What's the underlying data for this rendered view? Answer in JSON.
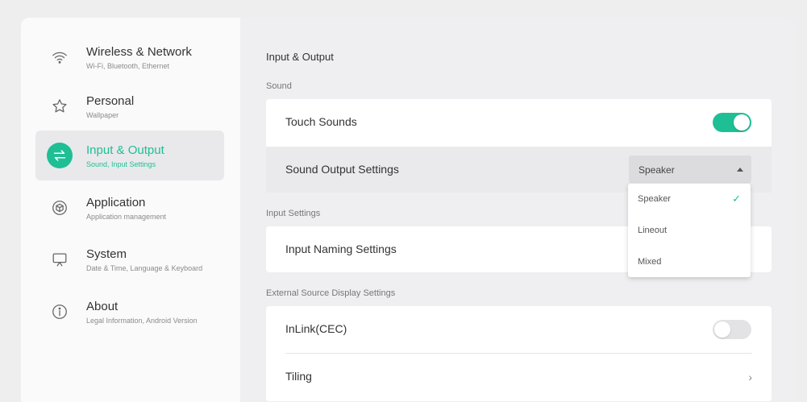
{
  "sidebar": {
    "items": [
      {
        "title": "Wireless & Network",
        "subtitle": "Wi-Fi, Bluetooth, Ethernet",
        "icon": "wifi-icon"
      },
      {
        "title": "Personal",
        "subtitle": "Wallpaper",
        "icon": "star-icon"
      },
      {
        "title": "Input & Output",
        "subtitle": "Sound, Input Settings",
        "icon": "swap-arrows-icon",
        "active": true
      },
      {
        "title": "Application",
        "subtitle": "Application management",
        "icon": "cube-icon"
      },
      {
        "title": "System",
        "subtitle": "Date & Time, Language & Keyboard",
        "icon": "monitor-icon"
      },
      {
        "title": "About",
        "subtitle": "Legal Information, Android Version",
        "icon": "info-icon"
      }
    ]
  },
  "main": {
    "title": "Input & Output",
    "sections": {
      "sound": {
        "label": "Sound",
        "touch_sounds": {
          "label": "Touch Sounds",
          "enabled": true
        },
        "sound_output": {
          "label": "Sound Output Settings",
          "value": "Speaker"
        }
      },
      "input": {
        "label": "Input Settings",
        "input_naming": {
          "label": "Input Naming Settings"
        }
      },
      "external": {
        "label": "External Source Display Settings",
        "inlink": {
          "label": "InLink(CEC)",
          "enabled": false
        },
        "tiling": {
          "label": "Tiling",
          "chevron": "›"
        }
      }
    }
  },
  "dropdown": {
    "options": [
      "Speaker",
      "Lineout",
      "Mixed"
    ],
    "selected": "Speaker",
    "check": "✓"
  },
  "colors": {
    "accent": "#1ebf94",
    "toggle_off": "#e3e3e5"
  }
}
